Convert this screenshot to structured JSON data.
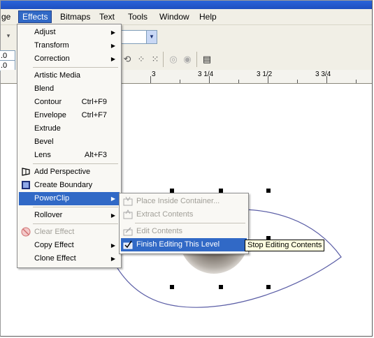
{
  "menubar": {
    "items": [
      "ge",
      "Effects",
      "Bitmaps",
      "Text",
      "Tools",
      "Window",
      "Help"
    ]
  },
  "toolbar": {
    "field1": ".0",
    "field2": ".0"
  },
  "ruler": {
    "labels": [
      "3",
      "3 1/4",
      "3 1/2",
      "3 3/4"
    ]
  },
  "effects_menu": {
    "items": [
      {
        "label": "Adjust",
        "submenu": true
      },
      {
        "label": "Transform",
        "submenu": true
      },
      {
        "label": "Correction",
        "submenu": true
      },
      {
        "label": "Artistic Media"
      },
      {
        "label": "Blend"
      },
      {
        "label": "Contour",
        "shortcut": "Ctrl+F9"
      },
      {
        "label": "Envelope",
        "shortcut": "Ctrl+F7"
      },
      {
        "label": "Extrude"
      },
      {
        "label": "Bevel"
      },
      {
        "label": "Lens",
        "shortcut": "Alt+F3"
      },
      {
        "label": "Add Perspective"
      },
      {
        "label": "Create Boundary"
      },
      {
        "label": "PowerClip",
        "submenu": true,
        "highlighted": true
      },
      {
        "label": "Rollover",
        "submenu": true
      },
      {
        "label": "Clear Effect",
        "disabled": true
      },
      {
        "label": "Copy Effect",
        "submenu": true
      },
      {
        "label": "Clone Effect",
        "submenu": true
      }
    ]
  },
  "powerclip_menu": {
    "items": [
      {
        "label": "Place Inside Container...",
        "disabled": true
      },
      {
        "label": "Extract Contents",
        "disabled": true
      },
      {
        "label": "Edit Contents",
        "disabled": true
      },
      {
        "label": "Finish Editing This Level",
        "highlighted": true
      }
    ]
  },
  "tooltip": "Stop Editing Contents",
  "colors": {
    "highlight": "#3169c6",
    "menu_bg": "#f9f8f4",
    "bar_bg": "#f1efe6",
    "outline": "#5b5ea6"
  }
}
